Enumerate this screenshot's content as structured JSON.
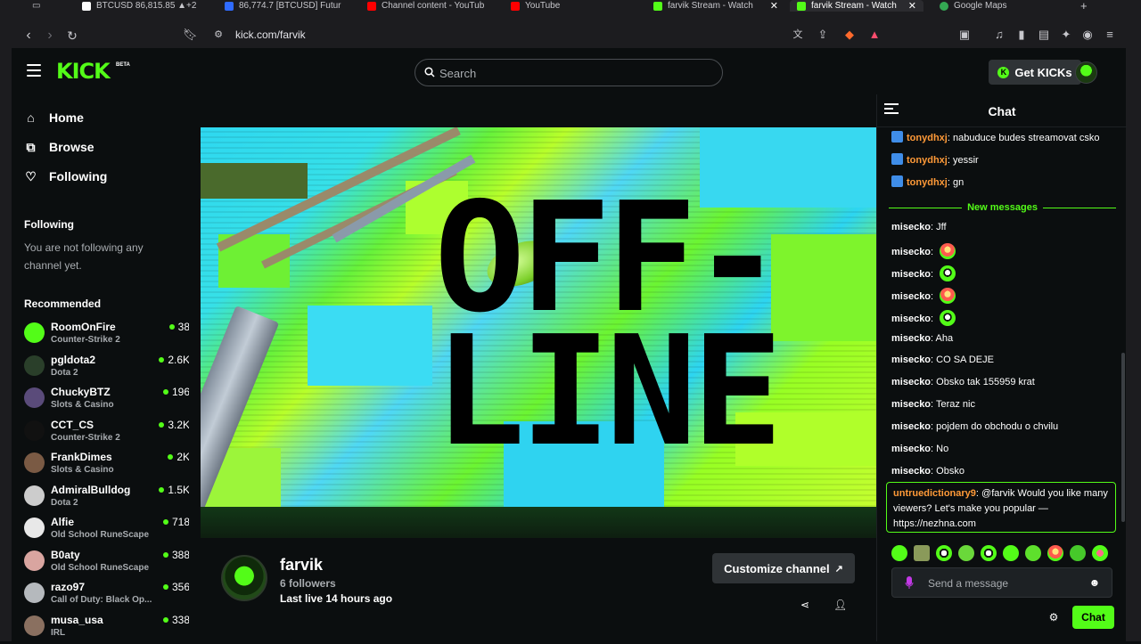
{
  "browser": {
    "tabs": [
      {
        "label": "BTCUSD 86,815.85 ▲+2",
        "color": "#ffffff"
      },
      {
        "label": "86,774.7 [BTCUSD] Futur",
        "color": "#2f6bff"
      },
      {
        "label": "Channel content - YouTub",
        "color": "#ff0000"
      },
      {
        "label": "YouTube",
        "color": "#ff0000"
      },
      {
        "label": "farvik Stream - Watch",
        "color": "#53fc18"
      },
      {
        "label": "farvik Stream - Watch",
        "color": "#53fc18"
      },
      {
        "label": "Google Maps",
        "color": "#34a853"
      }
    ],
    "url": "kick.com/farvik"
  },
  "header": {
    "logo": "KICK",
    "logo_badge": "BETA",
    "search_placeholder": "Search",
    "get_kicks_label": "Get KICKs"
  },
  "sidebar": {
    "nav": [
      {
        "label": "Home",
        "icon": "home-icon"
      },
      {
        "label": "Browse",
        "icon": "browse-icon"
      },
      {
        "label": "Following",
        "icon": "heart-icon"
      }
    ],
    "following_title": "Following",
    "following_empty": "You are not following any channel yet.",
    "recommended_title": "Recommended",
    "recommended": [
      {
        "name": "RoomOnFire",
        "game": "Counter-Strike 2",
        "viewers": "38",
        "color": "#53fc18"
      },
      {
        "name": "pgldota2",
        "game": "Dota 2",
        "viewers": "2.6K",
        "color": "#2a3f2a"
      },
      {
        "name": "ChuckyBTZ",
        "game": "Slots & Casino",
        "viewers": "196",
        "color": "#5a4b7a"
      },
      {
        "name": "CCT_CS",
        "game": "Counter-Strike 2",
        "viewers": "3.2K",
        "color": "#111111"
      },
      {
        "name": "FrankDimes",
        "game": "Slots & Casino",
        "viewers": "2K",
        "color": "#7a5a44"
      },
      {
        "name": "AdmiralBulldog",
        "game": "Dota 2",
        "viewers": "1.5K",
        "color": "#cccccc"
      },
      {
        "name": "Alfie",
        "game": "Old School RuneScape",
        "viewers": "718",
        "color": "#e8e8e8"
      },
      {
        "name": "B0aty",
        "game": "Old School RuneScape",
        "viewers": "388",
        "color": "#d9a5a0"
      },
      {
        "name": "razo97",
        "game": "Call of Duty: Black Op...",
        "viewers": "356",
        "color": "#b5b9bd"
      },
      {
        "name": "musa_usa",
        "game": "IRL",
        "viewers": "338",
        "color": "#8a7060"
      }
    ]
  },
  "player": {
    "offline_line1": "OFF-",
    "offline_line2": "LINE"
  },
  "channel": {
    "name": "farvik",
    "followers": "6 followers",
    "last_live": "Last live 14 hours ago",
    "customize_label": "Customize channel"
  },
  "chat": {
    "title": "Chat",
    "messages_top": [
      {
        "user": "tonydhxj",
        "text": "nabuduce budes streamovat csko"
      },
      {
        "user": "tonydhxj",
        "text": "yessir"
      },
      {
        "user": "tonydhxj",
        "text": "gn"
      }
    ],
    "new_messages_label": "New messages",
    "messages": [
      {
        "user": "misecko",
        "text": "Jff",
        "emote": ""
      },
      {
        "user": "misecko",
        "text": "",
        "emote": "e1"
      },
      {
        "user": "misecko",
        "text": "",
        "emote": "e2"
      },
      {
        "user": "misecko",
        "text": "",
        "emote": "e1"
      },
      {
        "user": "misecko",
        "text": "",
        "emote": "e2"
      },
      {
        "user": "misecko",
        "text": "Aha",
        "emote": ""
      },
      {
        "user": "misecko",
        "text": "CO SA DEJE",
        "emote": ""
      },
      {
        "user": "misecko",
        "text": "Obsko tak 155959 krat",
        "emote": ""
      },
      {
        "user": "misecko",
        "text": "Teraz nic",
        "emote": ""
      },
      {
        "user": "misecko",
        "text": "pojdem do obchodu o chvilu",
        "emote": ""
      },
      {
        "user": "misecko",
        "text": "No",
        "emote": ""
      },
      {
        "user": "misecko",
        "text": "Obsko",
        "emote": ""
      }
    ],
    "pinned": {
      "user": "untruedictionary9",
      "text": "@farvik Would you like many viewers? Let's make you popular — https://nezhna.com"
    },
    "input_placeholder": "Send a message",
    "send_label": "Chat"
  },
  "colors": {
    "accent": "#53fc18",
    "username_orange": "#ff9a38",
    "background": "#0b0e0f"
  }
}
